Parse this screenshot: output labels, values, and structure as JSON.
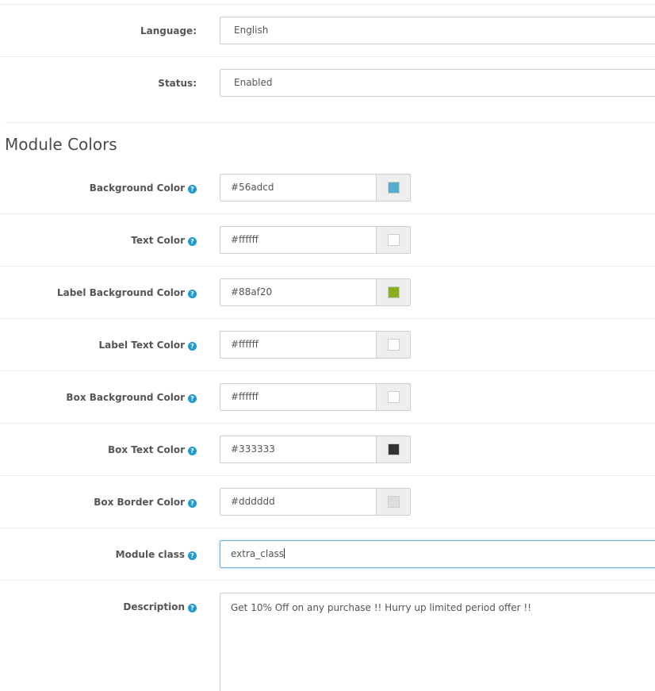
{
  "general": {
    "language": {
      "label": "Language:",
      "value": "English"
    },
    "status": {
      "label": "Status:",
      "value": "Enabled"
    }
  },
  "module_colors": {
    "title": "Module Colors",
    "help_glyph": "?",
    "fields": [
      {
        "label": "Background Color",
        "value": "#56adcd",
        "swatch": "#56adcd"
      },
      {
        "label": "Text Color",
        "value": "#ffffff",
        "swatch": "#ffffff"
      },
      {
        "label": "Label Background Color",
        "value": "#88af20",
        "swatch": "#88af20"
      },
      {
        "label": "Label Text Color",
        "value": "#ffffff",
        "swatch": "#ffffff"
      },
      {
        "label": "Box Background Color",
        "value": "#ffffff",
        "swatch": "#ffffff"
      },
      {
        "label": "Box Text Color",
        "value": "#333333",
        "swatch": "#333333"
      },
      {
        "label": "Box Border Color",
        "value": "#dddddd",
        "swatch": "#dddddd"
      }
    ]
  },
  "module_class": {
    "label": "Module class",
    "value": "extra_class"
  },
  "description": {
    "label": "Description",
    "value": "Get 10% Off on any purchase !! Hurry up limited period offer !!"
  },
  "colors": {
    "accent_focus": "#66afe9",
    "help_icon": "#1f9bcf"
  },
  "icons": {
    "help": "help-circle-icon"
  }
}
